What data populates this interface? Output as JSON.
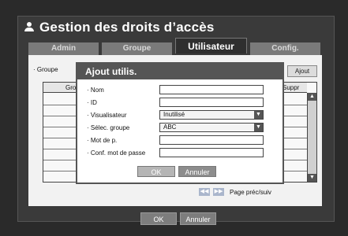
{
  "header": {
    "title": "Gestion des droits d’accès"
  },
  "tabs": [
    "Admin",
    "Groupe",
    "Utilisateur",
    "Config."
  ],
  "panel": {
    "group_label": "· Groupe",
    "add_button": "Ajout",
    "table": {
      "headers": [
        "Grou",
        "Suppr"
      ]
    },
    "pager": {
      "prev": "◀◀",
      "next": "▶▶",
      "label": "Page préc/suiv"
    }
  },
  "footer": {
    "ok": "OK",
    "cancel": "Annuler"
  },
  "dialog": {
    "title": "Ajout utilis.",
    "fields": [
      {
        "label": "· Nom",
        "value": ""
      },
      {
        "label": "· ID",
        "value": ""
      },
      {
        "label": "· Visualisateur",
        "value": "Inutilisé"
      },
      {
        "label": "· Sélec. groupe",
        "value": "ABC"
      },
      {
        "label": "· Mot de p.",
        "value": ""
      },
      {
        "label": "· Conf. mot de passe",
        "value": ""
      }
    ],
    "ok": "OK",
    "cancel": "Annuler"
  }
}
